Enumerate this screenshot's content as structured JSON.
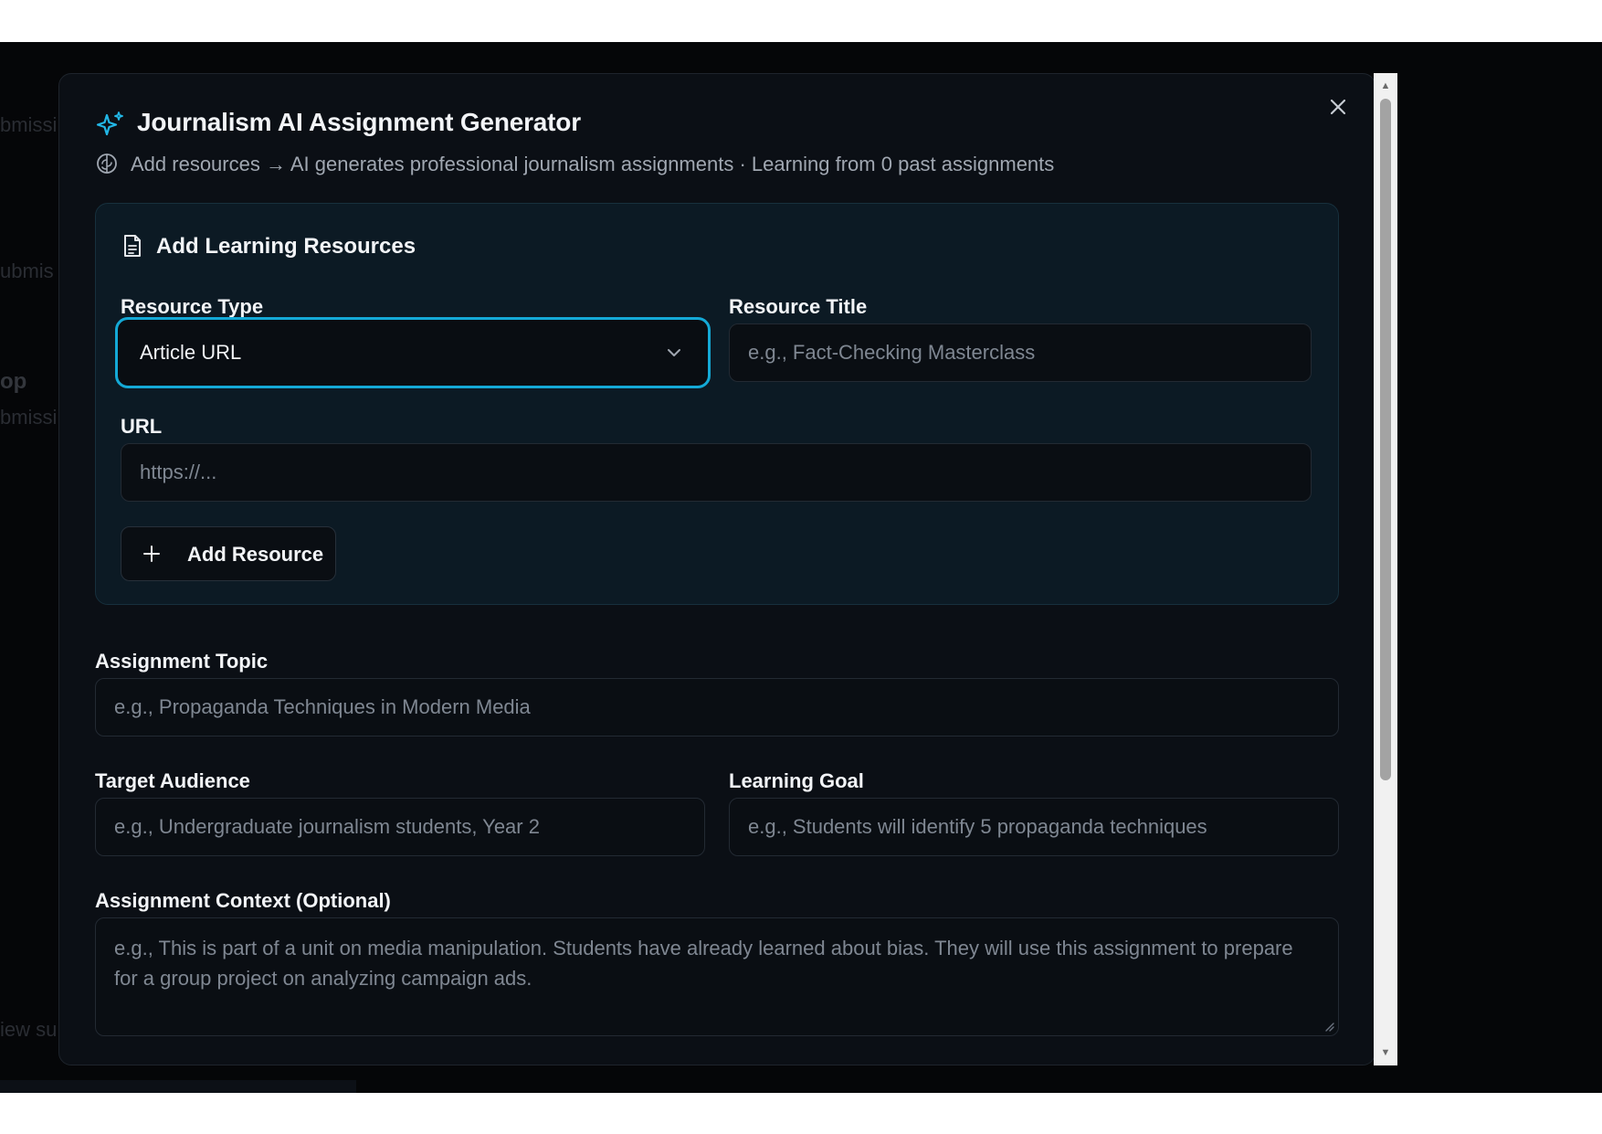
{
  "background": {
    "ghost_texts": [
      "bmissi",
      "ubmis",
      "op",
      "bmissi",
      "iew su"
    ]
  },
  "modal": {
    "title": "Journalism AI Assignment Generator",
    "subtitle": "Add resources → AI generates professional journalism assignments · Learning from 0 past assignments",
    "close_icon": "close-icon",
    "header_icon": "sparkles-icon",
    "subtitle_icon": "brain-icon"
  },
  "resources": {
    "title": "Add Learning Resources",
    "title_icon": "document-icon",
    "resource_type": {
      "label": "Resource Type",
      "value": "Article URL"
    },
    "resource_title": {
      "label": "Resource Title",
      "placeholder": "e.g., Fact-Checking Masterclass"
    },
    "url": {
      "label": "URL",
      "placeholder": "https://..."
    },
    "add_button": "Add Resource"
  },
  "form": {
    "topic": {
      "label": "Assignment Topic",
      "placeholder": "e.g., Propaganda Techniques in Modern Media"
    },
    "audience": {
      "label": "Target Audience",
      "placeholder": "e.g., Undergraduate journalism students, Year 2"
    },
    "goal": {
      "label": "Learning Goal",
      "placeholder": "e.g., Students will identify 5 propaganda techniques"
    },
    "context": {
      "label": "Assignment Context (Optional)",
      "placeholder": "e.g., This is part of a unit on media manipulation. Students have already learned about bias. They will use this assignment to prepare for a group project on analyzing campaign ads."
    }
  },
  "colors": {
    "accent": "#14a9d6",
    "modal_bg": "#0b0f15",
    "card_bg": "#0c1a24",
    "text": "#f2f4f7",
    "muted": "#7f8792"
  }
}
